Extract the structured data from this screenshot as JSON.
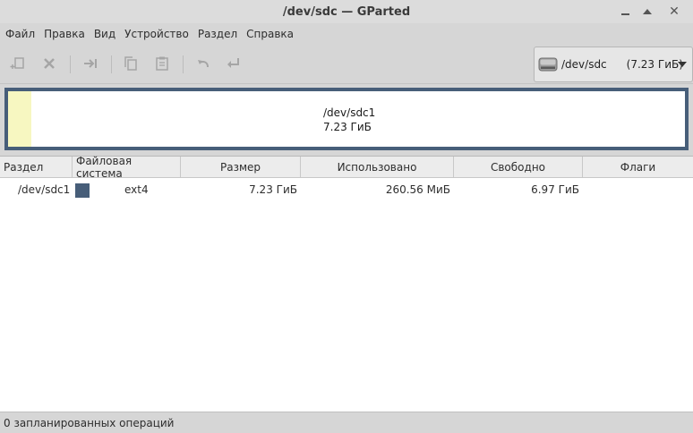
{
  "window": {
    "title": "/dev/sdc — GParted"
  },
  "menu": [
    "Файл",
    "Правка",
    "Вид",
    "Устройство",
    "Раздел",
    "Справка"
  ],
  "toolbar": {
    "icons": [
      "new-partition-icon",
      "delete-icon",
      "resize-move-icon",
      "copy-icon",
      "paste-icon",
      "undo-icon",
      "apply-icon"
    ]
  },
  "device": {
    "name": "/dev/sdc",
    "size": "(7.23 ГиБ)"
  },
  "diskmap": {
    "name": "/dev/sdc1",
    "size": "7.23 ГиБ"
  },
  "table": {
    "headers": [
      "Раздел",
      "Файловая система",
      "Размер",
      "Использовано",
      "Свободно",
      "Флаги"
    ],
    "rows": [
      {
        "partition": "/dev/sdc1",
        "filesystem": "ext4",
        "size": "7.23 ГиБ",
        "used": "260.56 МиБ",
        "free": "6.97 ГиБ",
        "flags": ""
      }
    ]
  },
  "status": "0 запланированных операций",
  "colors": {
    "ext4": "#475e79",
    "used": "#f7f7c1"
  }
}
